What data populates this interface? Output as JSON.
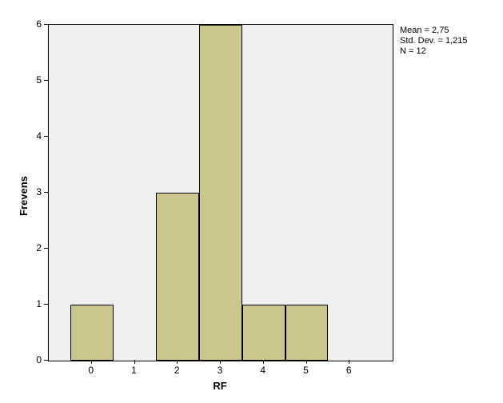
{
  "chart_data": {
    "type": "bar",
    "categories": [
      0,
      1,
      2,
      3,
      4,
      5,
      6
    ],
    "values": [
      1,
      0,
      3,
      6,
      1,
      1,
      0
    ],
    "xlabel": "RF",
    "ylabel": "Frevens",
    "ylim": [
      0,
      6
    ],
    "xlim": [
      -1,
      7
    ],
    "y_ticks": [
      0,
      1,
      2,
      3,
      4,
      5,
      6
    ],
    "x_ticks": [
      0,
      1,
      2,
      3,
      4,
      5,
      6
    ]
  },
  "stats": {
    "mean_label": "Mean = 2,75",
    "std_label": "Std. Dev. = 1,215",
    "n_label": "N = 12"
  }
}
